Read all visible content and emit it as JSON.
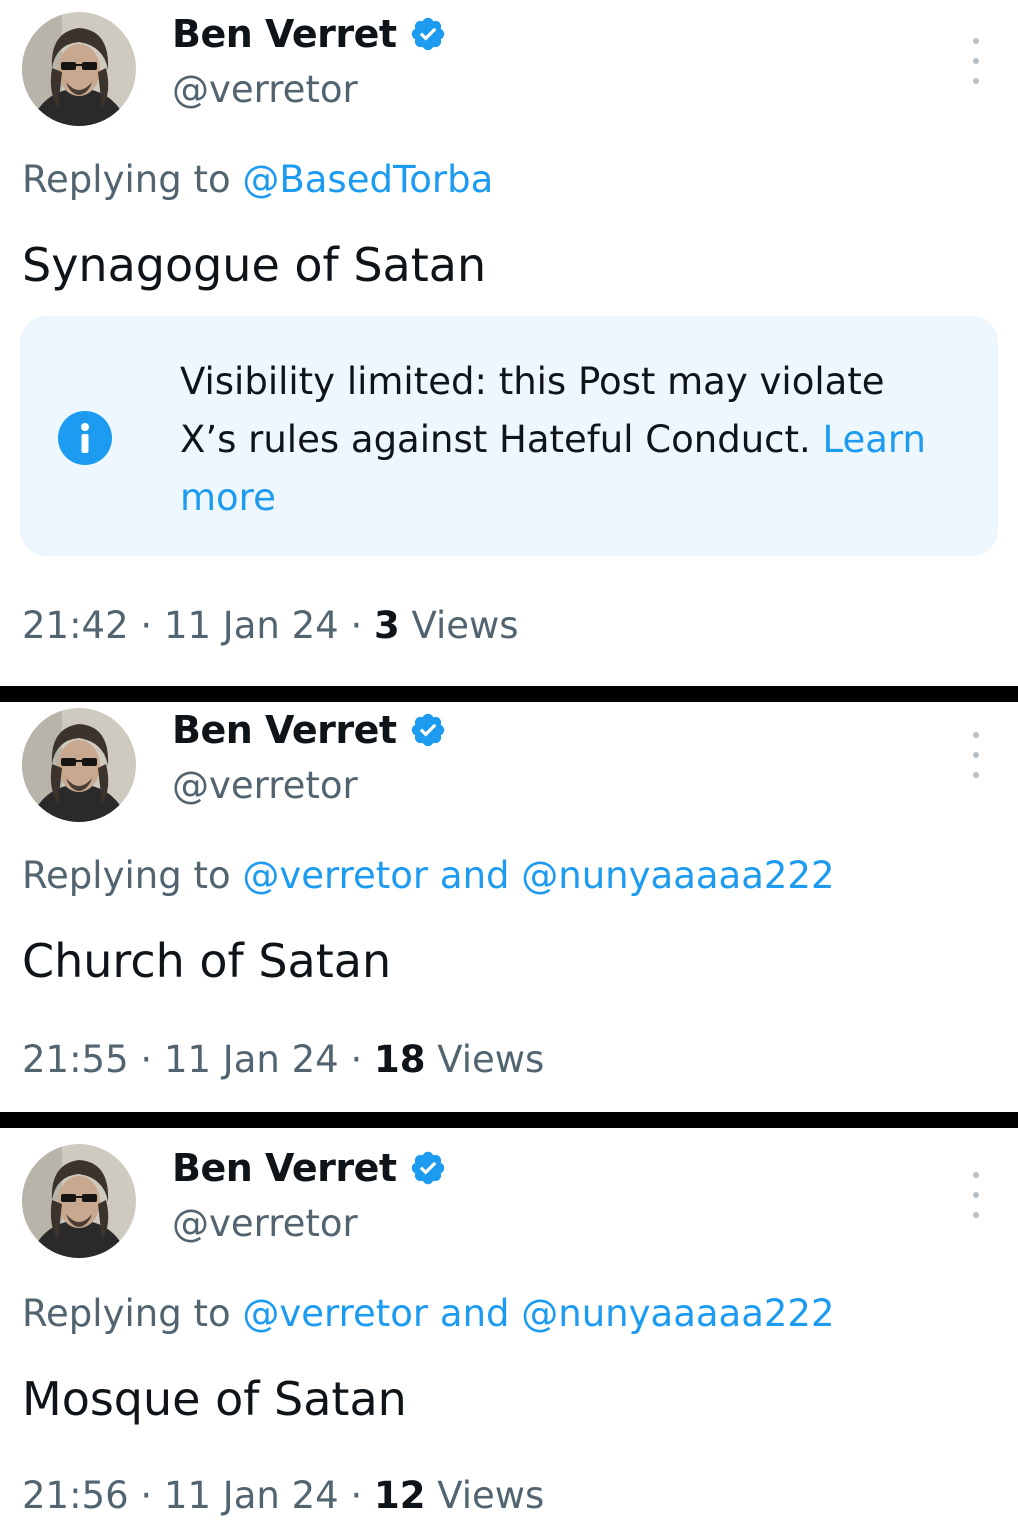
{
  "colors": {
    "accent": "#1d9bf0",
    "secondary_text": "#536471",
    "primary_text": "#0f1419",
    "notice_bg": "#edf7fd"
  },
  "posts": [
    {
      "author": {
        "name": "Ben Verret",
        "handle": "@verretor",
        "verified": true
      },
      "replying_prefix": "Replying to",
      "replying_to": [
        "@BasedTorba"
      ],
      "reply_joiner": "",
      "text": "Synagogue of Satan",
      "notice": {
        "icon": "info-icon",
        "line1": "Visibility limited: this Post may violate",
        "line2": "X’s rules against Hateful Conduct.",
        "link_part1": "Learn",
        "link_part2": "more"
      },
      "time": "21:42",
      "date": "11 Jan 24",
      "views_count": "3",
      "views_label": "Views"
    },
    {
      "author": {
        "name": "Ben Verret",
        "handle": "@verretor",
        "verified": true
      },
      "replying_prefix": "Replying to",
      "replying_to": [
        "@verretor",
        "@nunyaaaaa222"
      ],
      "reply_joiner": "and",
      "text": "Church of Satan",
      "time": "21:55",
      "date": "11 Jan 24",
      "views_count": "18",
      "views_label": "Views"
    },
    {
      "author": {
        "name": "Ben Verret",
        "handle": "@verretor",
        "verified": true
      },
      "replying_prefix": "Replying to",
      "replying_to": [
        "@verretor",
        "@nunyaaaaa222"
      ],
      "reply_joiner": "and",
      "text": "Mosque of Satan",
      "time": "21:56",
      "date": "11 Jan 24",
      "views_count": "12",
      "views_label": "Views"
    }
  ],
  "separator": "·"
}
